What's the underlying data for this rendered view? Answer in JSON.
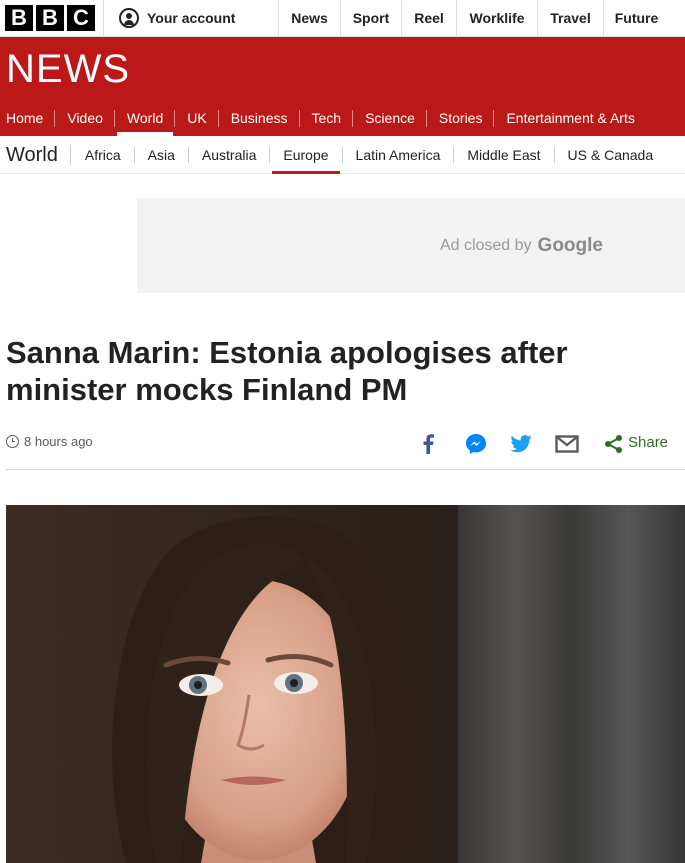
{
  "topbar": {
    "logo_letters": [
      "B",
      "B",
      "C"
    ],
    "account_label": "Your account",
    "links": [
      "News",
      "Sport",
      "Reel",
      "Worklife",
      "Travel",
      "Future"
    ]
  },
  "brand": "NEWS",
  "main_nav": {
    "items": [
      "Home",
      "Video",
      "World",
      "UK",
      "Business",
      "Tech",
      "Science",
      "Stories",
      "Entertainment & Arts"
    ],
    "active": "World"
  },
  "sub_nav": {
    "section": "World",
    "items": [
      "Africa",
      "Asia",
      "Australia",
      "Europe",
      "Latin America",
      "Middle East",
      "US & Canada"
    ],
    "active": "Europe"
  },
  "ad": {
    "text": "Ad closed by",
    "brand": "Google"
  },
  "article": {
    "headline": "Sanna Marin: Estonia apologises after minister mocks Finland PM",
    "timestamp": "8 hours ago",
    "share_label": "Share"
  },
  "colors": {
    "bbc_red": "#bb1919",
    "share_green": "#2b6e1e",
    "facebook": "#3b5998",
    "messenger": "#0084ff",
    "twitter": "#1da1f2"
  },
  "icons": [
    "account-icon",
    "clock-icon",
    "facebook-icon",
    "messenger-icon",
    "twitter-icon",
    "email-icon",
    "share-icon"
  ]
}
